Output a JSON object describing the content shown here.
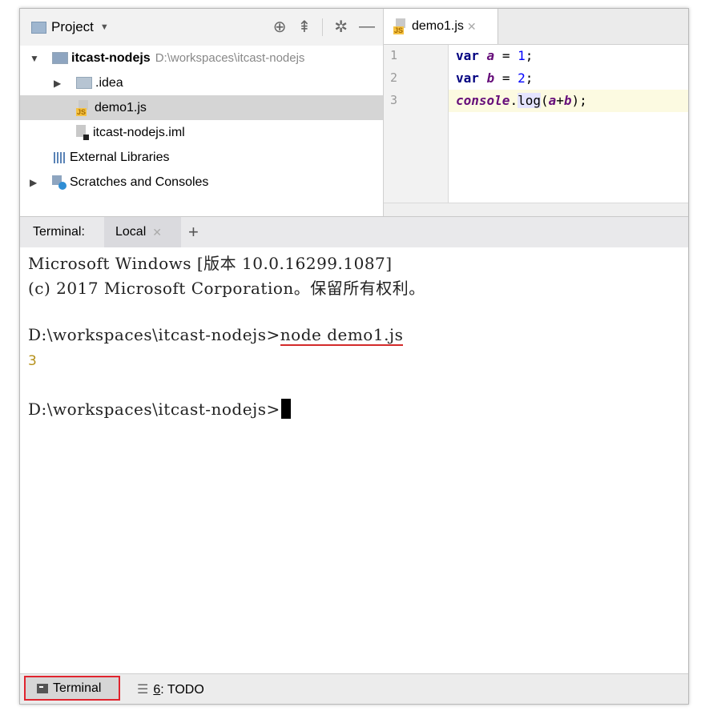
{
  "project": {
    "title": "Project",
    "tree": {
      "root_name": "itcast-nodejs",
      "root_path": "D:\\workspaces\\itcast-nodejs",
      "idea": ".idea",
      "demo": "demo1.js",
      "iml": "itcast-nodejs.iml",
      "libs": "External Libraries",
      "scratches": "Scratches and Consoles"
    }
  },
  "editor": {
    "tab_label": "demo1.js",
    "line_numbers": [
      "1",
      "2",
      "3"
    ],
    "code": {
      "l1_kw": "var",
      "l1_var": "a",
      "l1_eq": " = ",
      "l1_num": "1",
      "l1_end": ";",
      "l2_kw": "var",
      "l2_var": "b",
      "l2_eq": " = ",
      "l2_num": "2",
      "l2_end": ";",
      "l3_obj": "console",
      "l3_dot": ".",
      "l3_fn": "log",
      "l3_open": "(",
      "l3_a": "a",
      "l3_plus": "+",
      "l3_b": "b",
      "l3_close": ");"
    }
  },
  "terminal": {
    "label": "Terminal:",
    "tab_local": "Local",
    "lines": {
      "l1": "Microsoft Windows [版本 10.0.16299.1087]",
      "l2": "(c) 2017 Microsoft Corporation。保留所有权利。",
      "prompt1": "D:\\workspaces\\itcast-nodejs>",
      "command": "node demo1.js",
      "output": "3",
      "prompt2": "D:\\workspaces\\itcast-nodejs>"
    }
  },
  "statusbar": {
    "terminal": "Terminal",
    "todo_num": "6",
    "todo_label": ": TODO"
  },
  "colors": {
    "highlight_border": "#e0242e",
    "command_underline": "#d32a2a",
    "output_text": "#b5901a"
  }
}
